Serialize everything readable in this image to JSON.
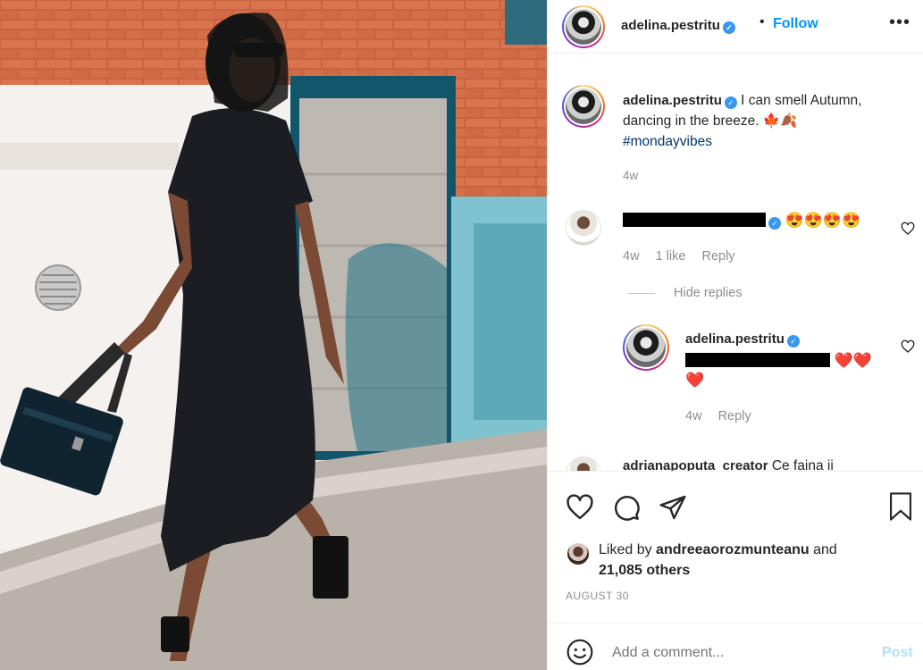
{
  "post": {
    "author": "adelina.pestritu",
    "verified_mark": "✓",
    "separator": "•",
    "follow_label": "Follow",
    "more_label": "•••"
  },
  "caption": {
    "author": "adelina.pestritu",
    "text": "I can smell Autumn, dancing in the breeze. 🍁🍂",
    "hashtag": "#mondayvibes",
    "time": "4w"
  },
  "comments": [
    {
      "author_redacted": true,
      "text": "😍😍😍😍",
      "time": "4w",
      "likes": "1 like",
      "reply_label": "Reply",
      "hide_replies_label": "Hide replies",
      "replies": [
        {
          "author": "adelina.pestritu",
          "text_emojis_1": "❤️❤️",
          "text_emojis_2": "❤️",
          "time": "4w",
          "reply_label": "Reply"
        }
      ]
    },
    {
      "author": "adrianapoputa_creator",
      "text": "Ce faina ii"
    }
  ],
  "actions": {
    "icons": [
      "heart-icon",
      "comment-icon",
      "share-icon",
      "bookmark-icon"
    ],
    "liked_prefix": "Liked by",
    "liked_user": "andreeaorozmunteanu",
    "liked_and": "and",
    "liked_others": "21,085 others",
    "date": "AUGUST 30"
  },
  "add_comment": {
    "placeholder": "Add a comment...",
    "post_label": "Post"
  },
  "colors": {
    "accent": "#0095f6",
    "verified": "#3897f0",
    "muted": "#8e8e8e",
    "post_disabled": "#b2dffc",
    "hashtag": "#00376b"
  }
}
